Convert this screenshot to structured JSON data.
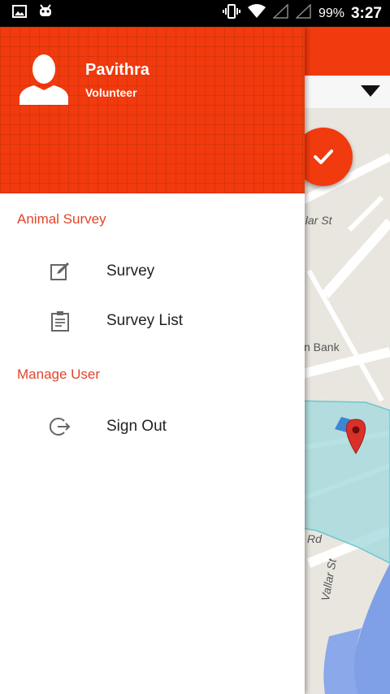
{
  "status_bar": {
    "battery_percent": "99%",
    "time": "3:27"
  },
  "map": {
    "labels": [
      "alar St",
      "n Bank",
      "Rd",
      "Vallar St"
    ]
  },
  "drawer": {
    "user": {
      "name": "Pavithra",
      "role": "Volunteer"
    },
    "sections": [
      {
        "title": "Animal Survey",
        "items": [
          {
            "label": "Survey",
            "icon": "edit-icon"
          },
          {
            "label": "Survey List",
            "icon": "clipboard-list-icon"
          }
        ]
      },
      {
        "title": "Manage User",
        "items": [
          {
            "label": "Sign Out",
            "icon": "sign-out-icon"
          }
        ]
      }
    ]
  },
  "colors": {
    "accent": "#f13a0e",
    "section_title": "#e0452b",
    "map_marker": "#d9302a"
  }
}
